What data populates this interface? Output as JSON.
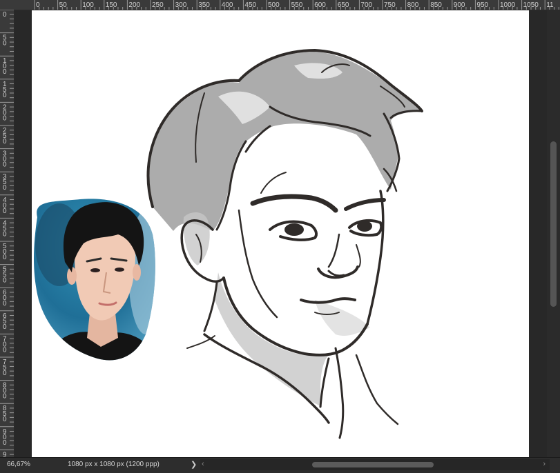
{
  "ruler": {
    "h_labels": [
      "0",
      "50",
      "100",
      "150",
      "200",
      "250",
      "300",
      "350",
      "400",
      "450",
      "500",
      "550",
      "600",
      "650",
      "700",
      "750",
      "800",
      "850",
      "900",
      "950",
      "1000",
      "1050",
      "11"
    ],
    "v_labels": [
      "0",
      "50",
      "100",
      "150",
      "200",
      "250",
      "300",
      "350",
      "400",
      "450",
      "500",
      "550",
      "600",
      "650",
      "700",
      "750",
      "800",
      "850",
      "900",
      "950"
    ]
  },
  "status": {
    "zoom": "66,67%",
    "doc_info": "1080 px x 1080 px (1200 ppp)",
    "arrow": "❯"
  },
  "icons": {
    "hscroll_left": "chevron-left-icon",
    "hscroll_right": "chevron-right-icon"
  }
}
